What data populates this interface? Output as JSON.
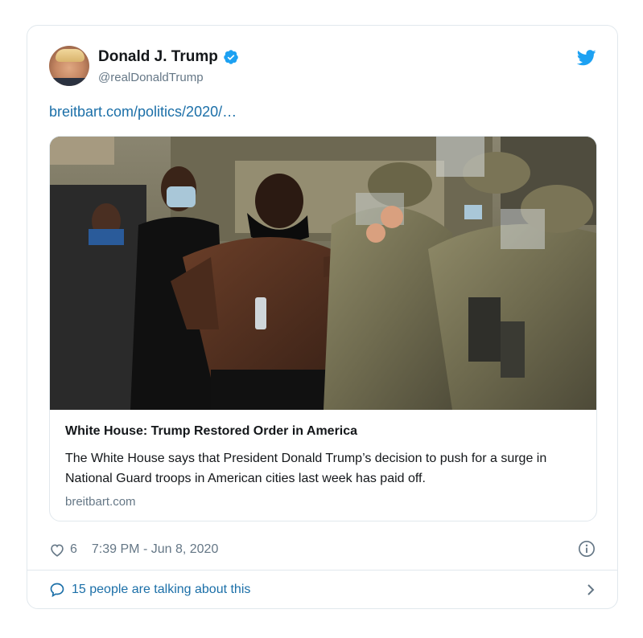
{
  "author": {
    "display_name": "Donald J. Trump",
    "handle": "@realDonaldTrump"
  },
  "tweet": {
    "link_text": "breitbart.com/politics/2020/…"
  },
  "link_card": {
    "title": "White House: Trump Restored Order in America",
    "description": "The White House says that President Donald Trump’s decision to push for a surge in National Guard troops in American cities last week has paid off.",
    "domain": "breitbart.com"
  },
  "meta": {
    "like_count": "6",
    "timestamp": "7:39 PM - Jun 8, 2020"
  },
  "conversation": {
    "label": "15 people are talking about this"
  },
  "colors": {
    "link_blue": "#1b6fa8",
    "twitter_blue": "#1da1f2",
    "muted_gray": "#657786",
    "border": "#e1e8ed"
  },
  "icons": {
    "verified": "verified-badge-icon",
    "twitter": "twitter-bird-icon",
    "heart": "heart-icon",
    "info": "info-icon",
    "comment": "comment-icon",
    "chevron": "chevron-right-icon"
  }
}
